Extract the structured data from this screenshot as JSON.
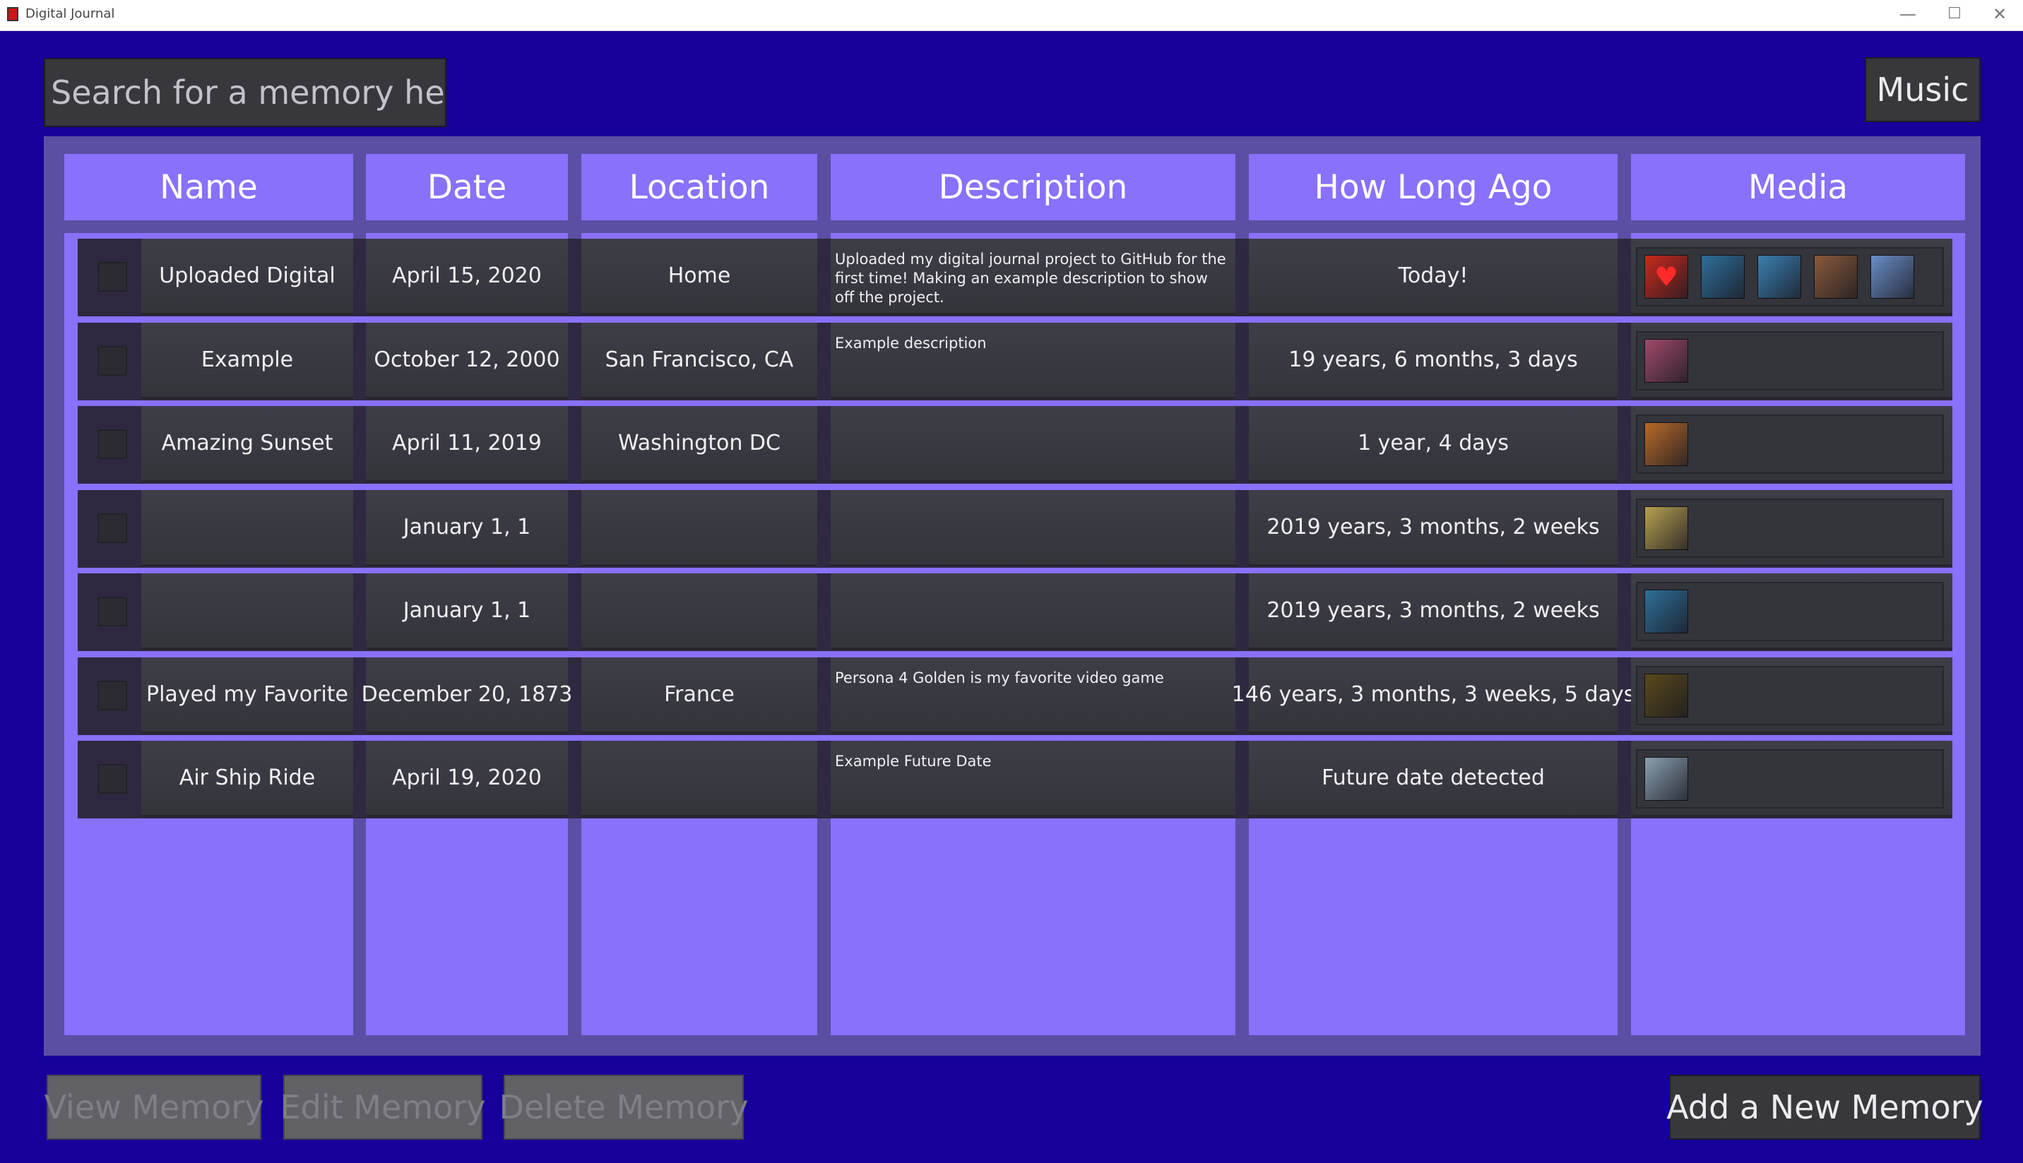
{
  "window": {
    "title": "Digital Journal",
    "minimize": "—",
    "maximize": "☐",
    "close": "✕"
  },
  "search": {
    "placeholder": "Search for a memory here!"
  },
  "music_button": "Music",
  "columns": {
    "name": "Name",
    "date": "Date",
    "location": "Location",
    "description": "Description",
    "how_long_ago": "How Long Ago",
    "media": "Media"
  },
  "rows": [
    {
      "name": "Uploaded Digital",
      "date": "April 15, 2020",
      "location": "Home",
      "description": "Uploaded my digital journal project to GitHub for the first time! Making an example description to show off the project.",
      "ago": "Today!",
      "media": [
        {
          "icon": "heart-thumbnail",
          "color": "#c82a1c"
        },
        {
          "icon": "island-thumbnail",
          "color": "#2e6f9a"
        },
        {
          "icon": "mountain-thumbnail",
          "color": "#3a7fb0"
        },
        {
          "icon": "sunset-city-thumbnail",
          "color": "#8a5a3a"
        },
        {
          "icon": "anime-thumbnail",
          "color": "#6a8ec8"
        }
      ]
    },
    {
      "name": "Example",
      "date": "October 12, 2000",
      "location": "San Francisco, CA",
      "description": "Example description",
      "ago": "19 years, 6 months, 3 days",
      "media": [
        {
          "icon": "characters-thumbnail",
          "color": "#a04a6a"
        }
      ]
    },
    {
      "name": "Amazing Sunset",
      "date": "April 11, 2019",
      "location": "Washington DC",
      "description": "",
      "ago": "1 year, 4 days",
      "media": [
        {
          "icon": "sunset-thumbnail",
          "color": "#b86a2a"
        }
      ]
    },
    {
      "name": "",
      "date": "January 1, 1",
      "location": "",
      "description": "",
      "ago": "2019 years, 3 months, 2 weeks",
      "media": [
        {
          "icon": "characters-thumbnail",
          "color": "#b8a050"
        }
      ]
    },
    {
      "name": "",
      "date": "January 1, 1",
      "location": "",
      "description": "",
      "ago": "2019 years, 3 months, 2 weeks",
      "media": [
        {
          "icon": "island-thumbnail",
          "color": "#2e6f9a"
        }
      ]
    },
    {
      "name": "Played my Favorite",
      "date": "December 20, 1873",
      "location": "France",
      "description": "Persona 4 Golden is my favorite video game",
      "ago": "146 years, 3 months, 3 weeks, 5 days",
      "media": [
        {
          "icon": "game-thumbnail",
          "color": "#5a4a1a"
        }
      ]
    },
    {
      "name": "Air Ship Ride",
      "date": "April 19, 2020",
      "location": "",
      "description": "Example Future Date",
      "ago": "Future date detected",
      "media": [
        {
          "icon": "airship-thumbnail",
          "color": "#8aa0b0"
        }
      ]
    }
  ],
  "buttons": {
    "view": "View Memory",
    "edit": "Edit Memory",
    "delete": "Delete Memory",
    "add": "Add a New Memory"
  },
  "colors": {
    "background": "#16009a",
    "column": "#8a70fb",
    "panel": "#5a4fa2",
    "cell": "#3a3a41",
    "text": "#f0f0f2"
  }
}
